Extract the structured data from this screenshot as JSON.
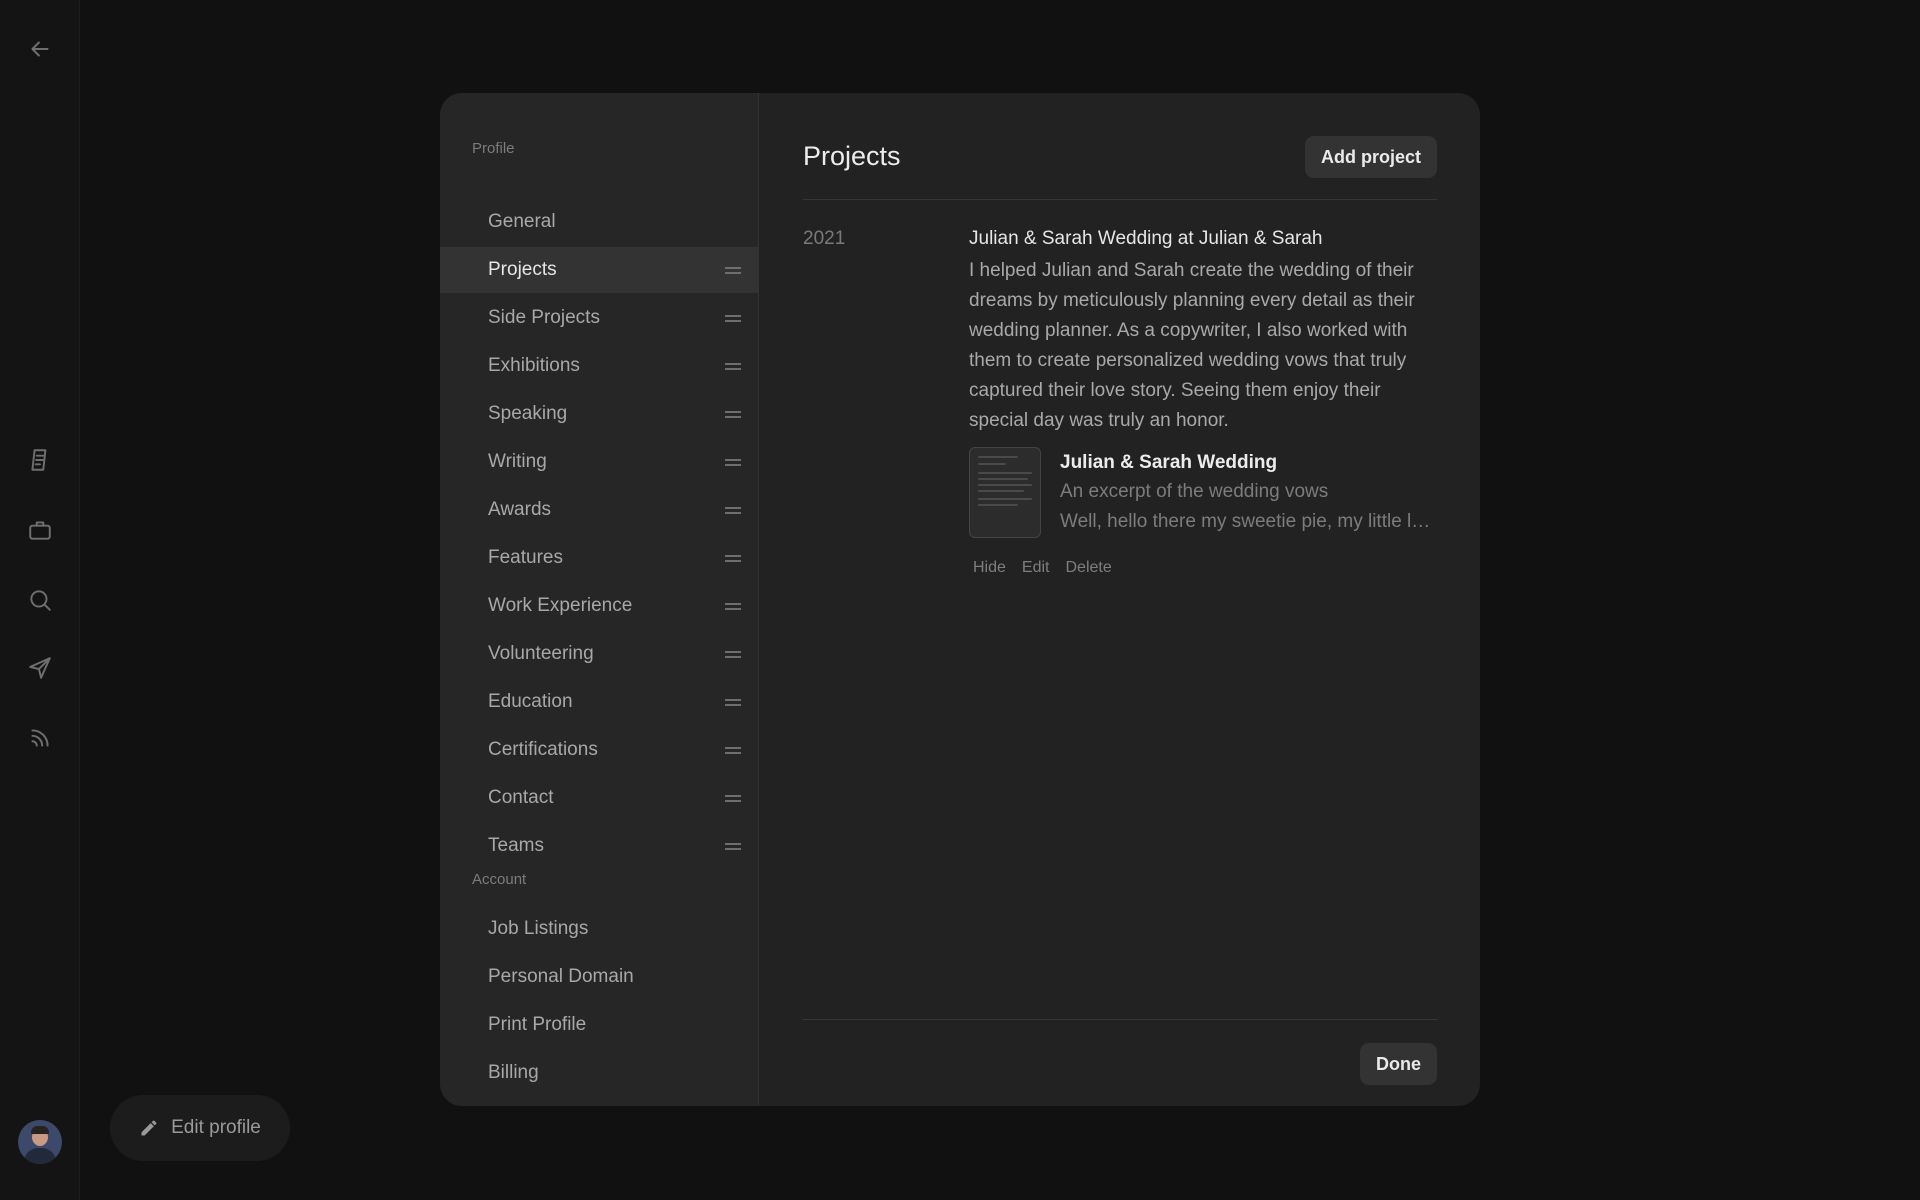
{
  "leftbar": {
    "icons": [
      "back-arrow-icon",
      "document-icon",
      "briefcase-icon",
      "search-icon",
      "send-icon",
      "rss-icon"
    ]
  },
  "edit_profile": {
    "label": "Edit profile",
    "icon": "pencil-icon"
  },
  "sidebar": {
    "profile_heading": "Profile",
    "profile_items": [
      {
        "label": "General",
        "draggable": false,
        "active": false
      },
      {
        "label": "Projects",
        "draggable": true,
        "active": true
      },
      {
        "label": "Side Projects",
        "draggable": true,
        "active": false
      },
      {
        "label": "Exhibitions",
        "draggable": true,
        "active": false
      },
      {
        "label": "Speaking",
        "draggable": true,
        "active": false
      },
      {
        "label": "Writing",
        "draggable": true,
        "active": false
      },
      {
        "label": "Awards",
        "draggable": true,
        "active": false
      },
      {
        "label": "Features",
        "draggable": true,
        "active": false
      },
      {
        "label": "Work Experience",
        "draggable": true,
        "active": false
      },
      {
        "label": "Volunteering",
        "draggable": true,
        "active": false
      },
      {
        "label": "Education",
        "draggable": true,
        "active": false
      },
      {
        "label": "Certifications",
        "draggable": true,
        "active": false
      },
      {
        "label": "Contact",
        "draggable": true,
        "active": false
      },
      {
        "label": "Teams",
        "draggable": true,
        "active": false
      }
    ],
    "account_heading": "Account",
    "account_items": [
      {
        "label": "Job Listings"
      },
      {
        "label": "Personal Domain"
      },
      {
        "label": "Print Profile"
      },
      {
        "label": "Billing"
      }
    ]
  },
  "main": {
    "title": "Projects",
    "add_button": "Add project",
    "project": {
      "year": "2021",
      "title": "Julian & Sarah Wedding at Julian & Sarah",
      "description": "I helped Julian and Sarah create the wedding of their dreams by meticulously planning every detail as their wedding planner. As a copywriter, I also worked with them to create personalized wedding vows that truly captured their love story. Seeing them enjoy their special day was truly an honor.",
      "attachment": {
        "title": "Julian & Sarah Wedding",
        "subtitle": "An excerpt of the wedding vows",
        "excerpt": "Well, hello there my sweetie pie, my little love"
      },
      "actions": {
        "hide": "Hide",
        "edit": "Edit",
        "delete": "Delete"
      }
    },
    "done_button": "Done"
  },
  "colors": {
    "background": "#111111",
    "modal": "#222222",
    "sidebar": "#262626",
    "active_item": "#333333"
  }
}
